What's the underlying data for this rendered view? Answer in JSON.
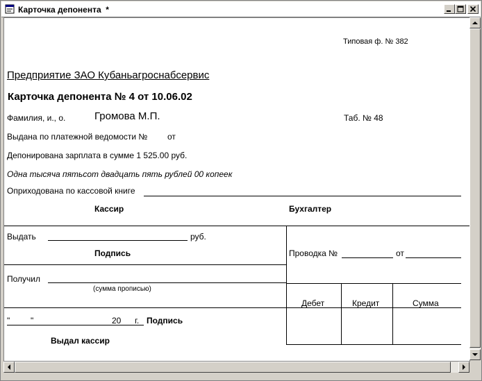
{
  "window": {
    "title": "Карточка депонента  *",
    "icons": [
      "document-icon",
      "minimize-icon",
      "maximize-icon",
      "close-icon"
    ]
  },
  "doc": {
    "form_number": "Типовая ф. № 382",
    "enterprise": "Предприятие ЗАО Кубаньагроснабсервис",
    "heading": "Карточка депонента № 4 от 10.06.02",
    "fio_label": "Фамилия, и., о.",
    "fio_value": "Громова М.П.",
    "tab_no": "Таб. № 48",
    "issued_label": "Выдана по платежной ведомости №",
    "issued_from": "от",
    "deposited": "Депонирована зарплата в сумме 1 525.00 руб.",
    "amount_words": "Одна тысяча пятьсот двадцать пять рублей 00 копеек",
    "posted": "Оприходована по кассовой книге",
    "cashier": "Кассир",
    "accountant": "Бухгалтер",
    "pay_label": "Выдать",
    "rub": "руб.",
    "signature": "Подпись",
    "entry_label": "Проводка №",
    "entry_from": "от",
    "received_label": "Получил",
    "sum_words_hint": "(сумма прописью)",
    "debit": "Дебет",
    "credit": "Кредит",
    "sum": "Сумма",
    "quote_open": "\"",
    "quote_close": "\"",
    "year_prefix": "20",
    "year_suffix": "г.",
    "signature2": "Подпись",
    "issued_by": "Выдал кассир"
  }
}
